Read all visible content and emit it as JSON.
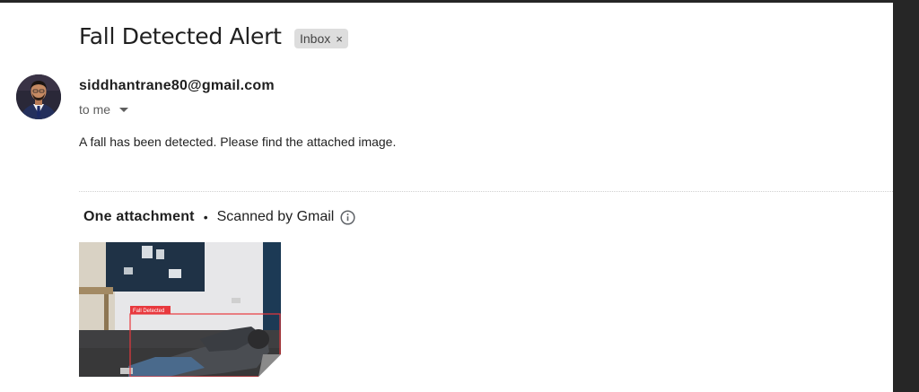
{
  "email": {
    "subject": "Fall Detected Alert",
    "label": "Inbox",
    "label_remove": "×",
    "sender": "siddhantrane80@gmail.com",
    "recipient": "to me",
    "body": "A fall has been detected. Please find the attached image."
  },
  "attachments": {
    "title": "One attachment",
    "separator": "•",
    "scan_status": "Scanned by Gmail",
    "items": [
      {
        "icon": "image-thumbnail",
        "detection_label": "Fall Detected"
      }
    ]
  },
  "colors": {
    "detection_box": "#e8383d",
    "chip_background": "#dddddd",
    "page_background": "#ffffff",
    "frame": "#262626"
  }
}
